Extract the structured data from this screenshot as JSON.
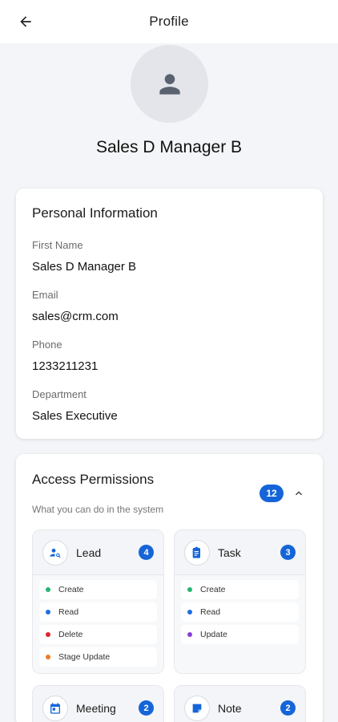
{
  "header": {
    "title": "Profile",
    "back_icon": "arrow-left-icon"
  },
  "profile": {
    "avatar_icon": "person-icon",
    "name": "Sales D Manager B"
  },
  "personal_info": {
    "title": "Personal Information",
    "fields": [
      {
        "label": "First Name",
        "value": "Sales D Manager B"
      },
      {
        "label": "Email",
        "value": "sales@crm.com"
      },
      {
        "label": "Phone",
        "value": "1233211231"
      },
      {
        "label": "Department",
        "value": "Sales Executive"
      }
    ]
  },
  "access": {
    "title": "Access Permissions",
    "subtitle": "What you can do in the system",
    "total": "12",
    "expanded": true,
    "modules": [
      {
        "name": "Lead",
        "icon": "person-search-icon",
        "count": "4",
        "actions": [
          {
            "label": "Create",
            "color": "#22b573"
          },
          {
            "label": "Read",
            "color": "#1e6fe0"
          },
          {
            "label": "Delete",
            "color": "#e0242f"
          },
          {
            "label": "Stage Update",
            "color": "#f07a22"
          }
        ]
      },
      {
        "name": "Task",
        "icon": "clipboard-icon",
        "count": "3",
        "actions": [
          {
            "label": "Create",
            "color": "#22b573"
          },
          {
            "label": "Read",
            "color": "#1e6fe0"
          },
          {
            "label": "Update",
            "color": "#8b3fd6"
          }
        ]
      },
      {
        "name": "Meeting",
        "icon": "calendar-icon",
        "count": "2",
        "actions": []
      },
      {
        "name": "Note",
        "icon": "note-icon",
        "count": "2",
        "actions": []
      }
    ]
  },
  "colors": {
    "accent": "#1565d8",
    "background": "#f3f5f8",
    "card": "#ffffff"
  }
}
